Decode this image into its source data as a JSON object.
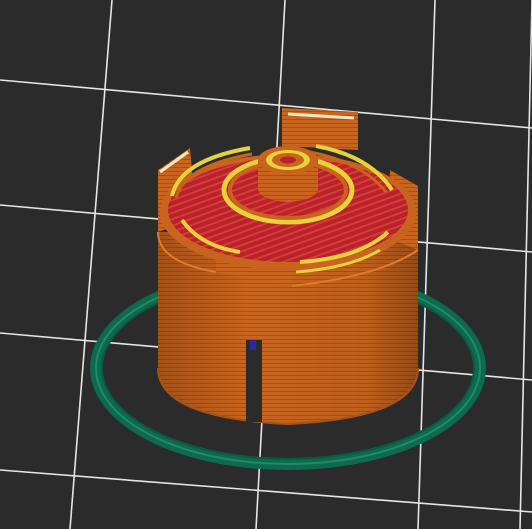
{
  "viewport": {
    "background": "#2b2b2b",
    "grid_color": "#e6e6e6"
  },
  "colors": {
    "outer_wall": "#c8641e",
    "outer_wall_dark": "#a8501a",
    "outer_wall_light": "#e07a2c",
    "infill": "#b8222a",
    "inner_perimeter": "#e6d23a",
    "top_edge": "#f0e8c8",
    "skirt": "#0e6a4e",
    "skirt_light": "#1f8a66",
    "support_blue": "#2a2aa0"
  },
  "icons": {
    "model": "3d-print-model-preview"
  }
}
